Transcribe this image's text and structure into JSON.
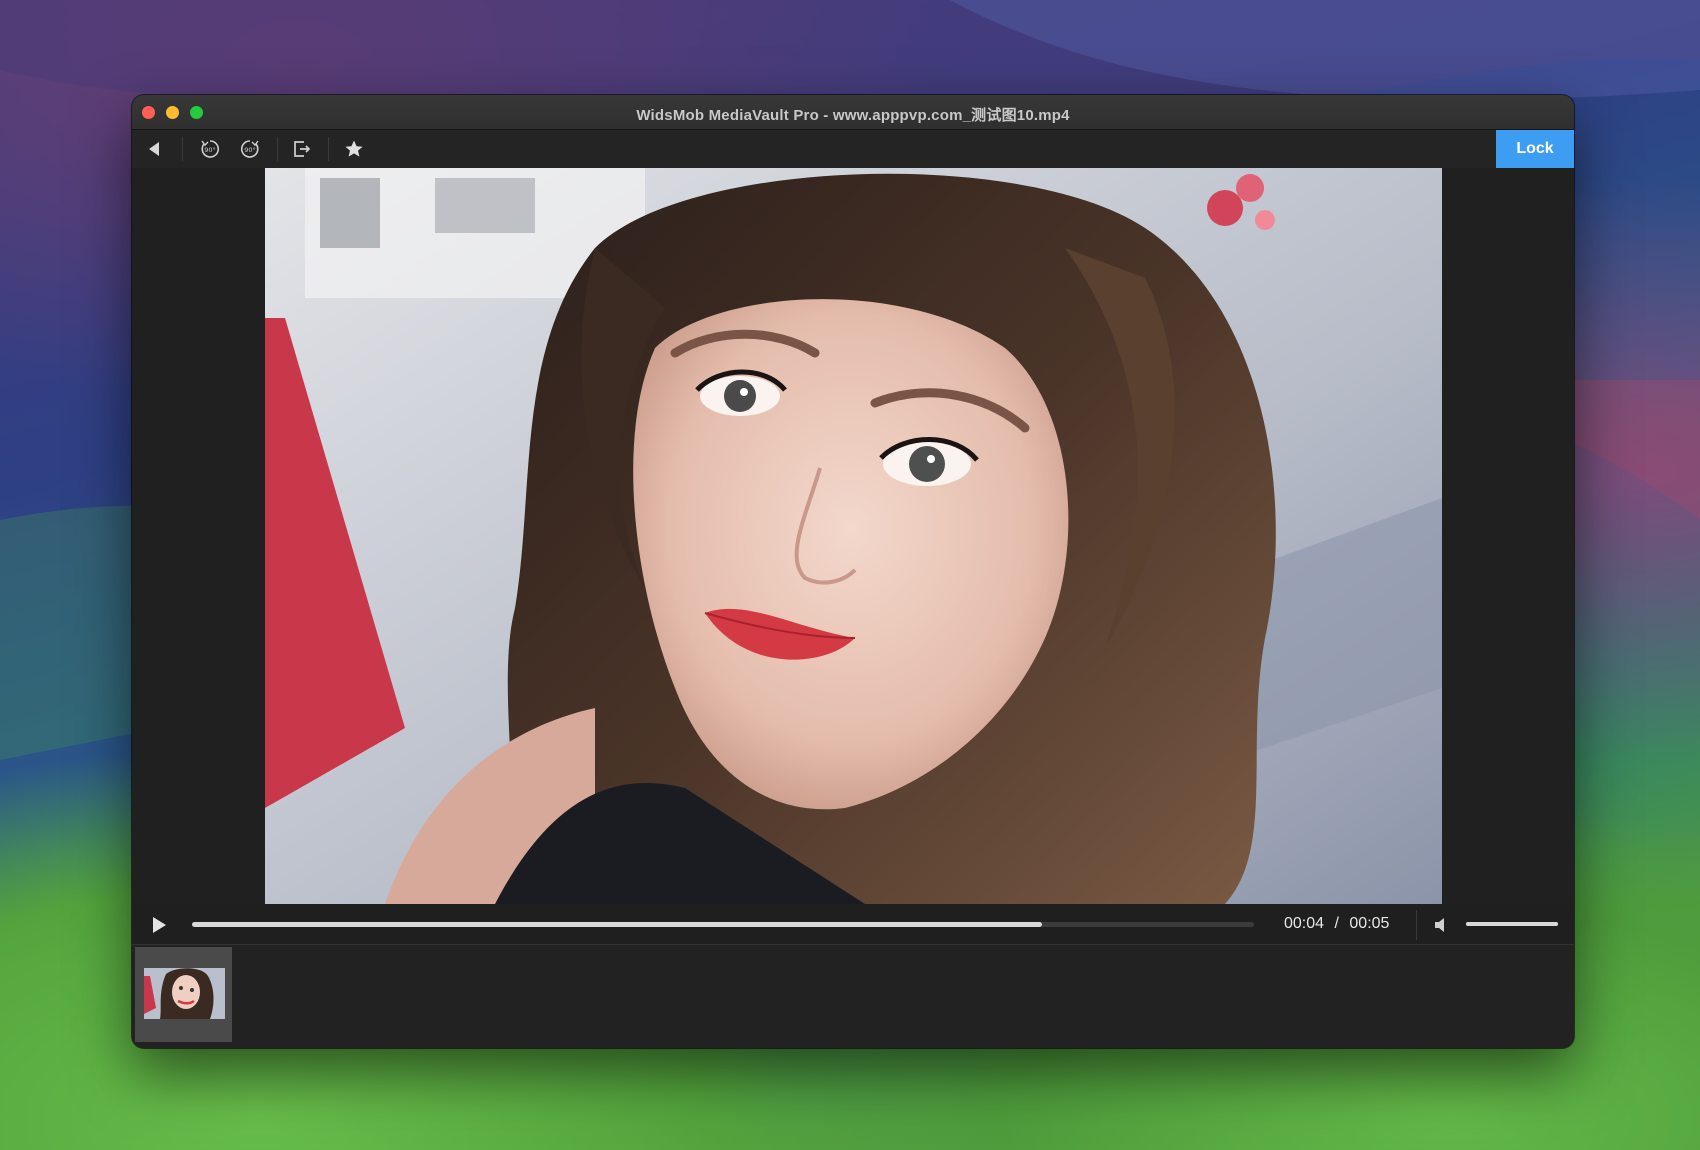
{
  "window": {
    "title": "WidsMob MediaVault Pro - www.apppvp.com_测试图10.mp4"
  },
  "toolbar": {
    "back_icon": "back-arrow-icon",
    "rotate_left_icon": "rotate-left-90-icon",
    "rotate_right_icon": "rotate-right-90-icon",
    "export_icon": "export-icon",
    "favorite_icon": "star-icon",
    "lock_label": "Lock"
  },
  "player": {
    "current_time": "00:04",
    "separator": "/",
    "total_time": "00:05",
    "progress_fraction": 0.8,
    "volume_fraction": 1.0
  },
  "colors": {
    "accent": "#3d9df2",
    "window_bg": "#1f1f1f",
    "close": "#ff5f57",
    "minimize": "#febc2e",
    "maximize": "#28c840"
  }
}
